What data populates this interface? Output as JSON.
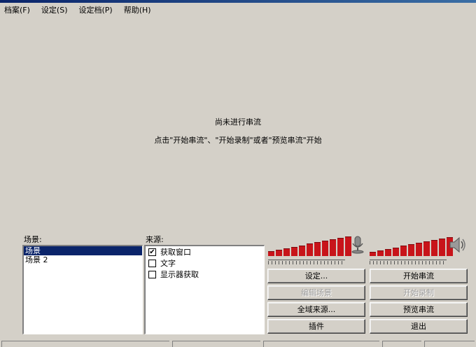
{
  "menu": {
    "items": [
      "档案(F)",
      "设定(S)",
      "设定档(P)",
      "帮助(H)"
    ]
  },
  "preview": {
    "line1": "尚未进行串流",
    "line2": "点击\"开始串流\"、\"开始录制\"或者\"预览串流\"开始"
  },
  "scenes": {
    "label": "场景:",
    "items": [
      "场景",
      "场景 2"
    ],
    "selected_index": 0
  },
  "sources": {
    "label": "来源:",
    "items": [
      {
        "label": "获取窗口",
        "checked": true
      },
      {
        "label": "文字",
        "checked": false
      },
      {
        "label": "显示器获取",
        "checked": false
      }
    ]
  },
  "audio": {
    "mic_icon": "microphone-icon",
    "speaker_icon": "speaker-icon",
    "mic_level_bars": [
      0.2,
      0.27,
      0.34,
      0.41,
      0.48,
      0.55,
      0.62,
      0.69,
      0.76,
      0.83,
      0.9
    ],
    "desktop_level_bars": [
      0.17,
      0.24,
      0.31,
      0.38,
      0.45,
      0.52,
      0.6,
      0.67,
      0.74,
      0.81,
      0.88
    ]
  },
  "buttons": {
    "settings": "设定...",
    "edit_scene": "编辑场景",
    "global_sources": "全域来源...",
    "plugins": "插件",
    "start_stream": "开始串流",
    "start_record": "开始录制",
    "preview_stream": "预览串流",
    "exit": "退出"
  },
  "colors": {
    "window_bg": "#d4d0c8",
    "meter_red": "#c8141a",
    "selection": "#0a246a"
  }
}
